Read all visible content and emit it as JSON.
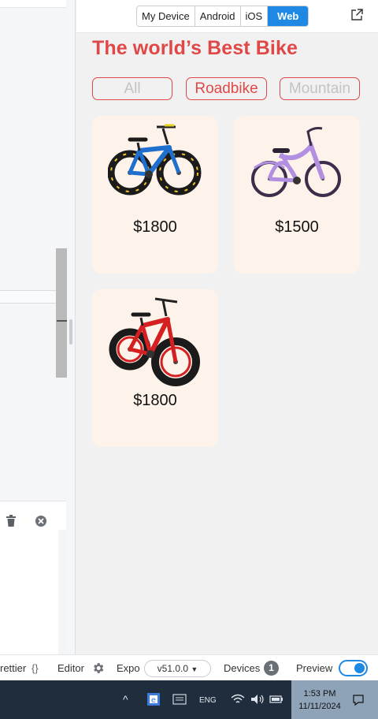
{
  "preview": {
    "device_tabs": [
      "My Device",
      "Android",
      "iOS",
      "Web"
    ],
    "active_tab": "Web",
    "title": "The world’s Best Bike",
    "filters": [
      {
        "label": "All",
        "active": false
      },
      {
        "label": "Roadbike",
        "active": true
      },
      {
        "label": "Mountain",
        "active": false
      }
    ],
    "products": [
      {
        "price": "$1800",
        "image": "blue-fat-tire-bike"
      },
      {
        "price": "$1500",
        "image": "purple-cruiser-bike"
      },
      {
        "price": "$1800",
        "image": "red-fat-tire-bike"
      }
    ]
  },
  "statusbar": {
    "prettier_label": "rettier",
    "braces": "{}",
    "editor_label": "Editor",
    "expo_label": "Expo",
    "version": "v51.0.0",
    "devices_label": "Devices",
    "devices_count": "1",
    "preview_label": "Preview",
    "preview_enabled": true
  },
  "taskbar": {
    "language": "ENG",
    "time": "1:53 PM",
    "date": "11/11/2024"
  },
  "colors": {
    "accent_red": "#e04848",
    "active_blue": "#1e88e5",
    "card_bg": "#fdf3ea"
  }
}
